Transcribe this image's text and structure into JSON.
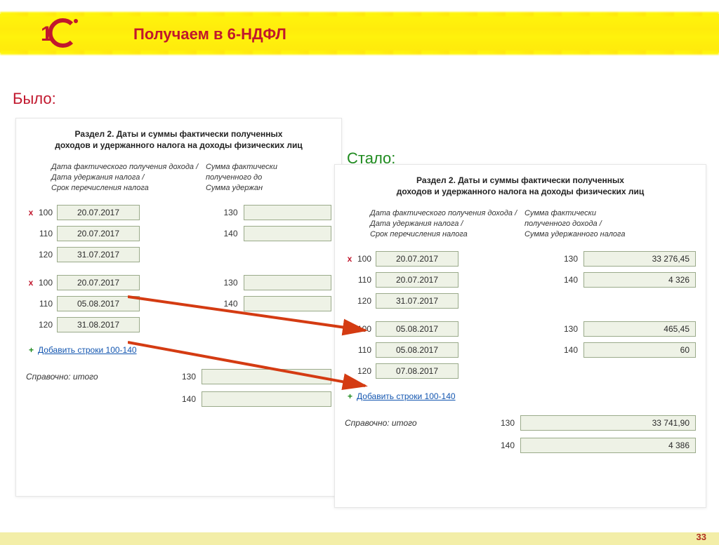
{
  "page": {
    "title": "Получаем в 6-НДФЛ",
    "number": "33"
  },
  "labels": {
    "was": "Было:",
    "now": "Стало:"
  },
  "section_title_line1": "Раздел 2.  Даты и суммы фактически полученных",
  "section_title_line2": "доходов и удержанного налога на доходы физических лиц",
  "col_left_lines": [
    "Дата фактического получения дохода /",
    "Дата удержания налога /",
    "Срок перечисления налога"
  ],
  "col_right_lines_was": [
    "Сумма фактически",
    "полученного до",
    "Сумма удержан"
  ],
  "col_right_lines_now": [
    "Сумма фактически",
    "полученного дохода /",
    "Сумма удержанного налога"
  ],
  "add_link": "Добавить строки 100-140",
  "totals_label": "Справочно: итого",
  "was": {
    "blocks": [
      {
        "rows": [
          {
            "x": true,
            "code": "100",
            "date": "20.07.2017",
            "code_r": "130",
            "amount": ""
          },
          {
            "x": false,
            "code": "110",
            "date": "20.07.2017",
            "code_r": "140",
            "amount": ""
          },
          {
            "x": false,
            "code": "120",
            "date": "31.07.2017"
          }
        ]
      },
      {
        "rows": [
          {
            "x": true,
            "code": "100",
            "date": "20.07.2017",
            "code_r": "130",
            "amount": ""
          },
          {
            "x": false,
            "code": "110",
            "date": "05.08.2017",
            "code_r": "140",
            "amount": ""
          },
          {
            "x": false,
            "code": "120",
            "date": "31.08.2017"
          }
        ]
      }
    ],
    "totals": [
      {
        "code_r": "130",
        "amount": ""
      },
      {
        "code_r": "140",
        "amount": ""
      }
    ]
  },
  "now": {
    "blocks": [
      {
        "rows": [
          {
            "x": true,
            "code": "100",
            "date": "20.07.2017",
            "code_r": "130",
            "amount": "33 276,45"
          },
          {
            "x": false,
            "code": "110",
            "date": "20.07.2017",
            "code_r": "140",
            "amount": "4 326"
          },
          {
            "x": false,
            "code": "120",
            "date": "31.07.2017"
          }
        ]
      },
      {
        "rows": [
          {
            "x": true,
            "code": "100",
            "date": "05.08.2017",
            "code_r": "130",
            "amount": "465,45"
          },
          {
            "x": false,
            "code": "110",
            "date": "05.08.2017",
            "code_r": "140",
            "amount": "60"
          },
          {
            "x": false,
            "code": "120",
            "date": "07.08.2017"
          }
        ]
      }
    ],
    "totals": [
      {
        "code_r": "130",
        "amount": "33 741,90"
      },
      {
        "code_r": "140",
        "amount": "4 386"
      }
    ]
  }
}
